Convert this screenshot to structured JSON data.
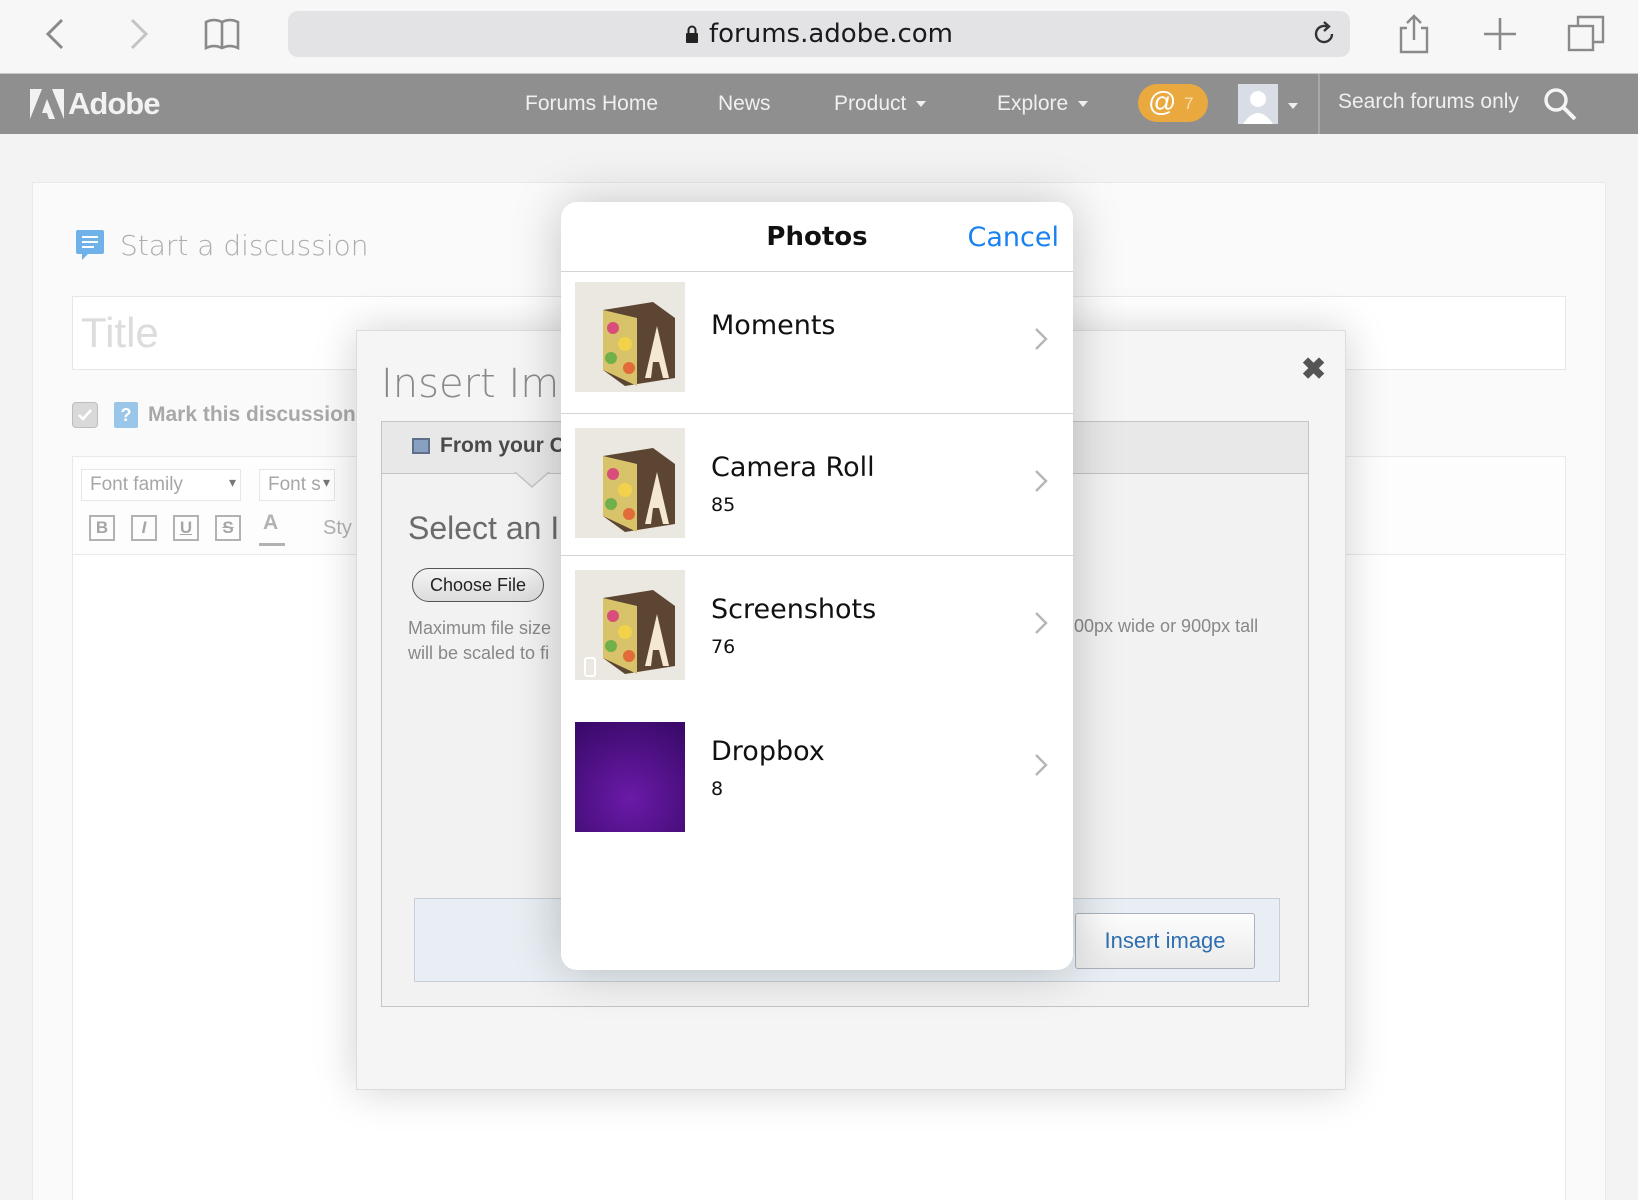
{
  "browser": {
    "url": "forums.adobe.com"
  },
  "nav": {
    "brand": "Adobe",
    "links": [
      "Forums Home",
      "News",
      "Product",
      "Explore"
    ],
    "mention_icon": "@",
    "mention_count": "7",
    "search_placeholder": "Search forums only"
  },
  "page": {
    "start_discussion": "Start a discussion",
    "title_placeholder": "Title",
    "mark_text": "Mark this discussion a",
    "font_family": "Font family",
    "font_size": "Font s",
    "format_buttons": [
      "B",
      "I",
      "U",
      "S",
      "A"
    ],
    "styles_label": "Sty"
  },
  "insert_dialog": {
    "title": "Insert Imag",
    "close_icon": "✖",
    "tab_label": "From your C",
    "select_heading": "Select an I",
    "choose_file": "Choose File",
    "help_line1": "Maximum file size",
    "help_line2": "will be scaled to fi",
    "help_right": "00px wide or 900px tall",
    "insert_button": "Insert image"
  },
  "photos": {
    "title": "Photos",
    "cancel": "Cancel",
    "albums": [
      {
        "name": "Moments",
        "count": ""
      },
      {
        "name": "Camera Roll",
        "count": "85"
      },
      {
        "name": "Screenshots",
        "count": "76"
      },
      {
        "name": "Dropbox",
        "count": "8"
      }
    ]
  }
}
